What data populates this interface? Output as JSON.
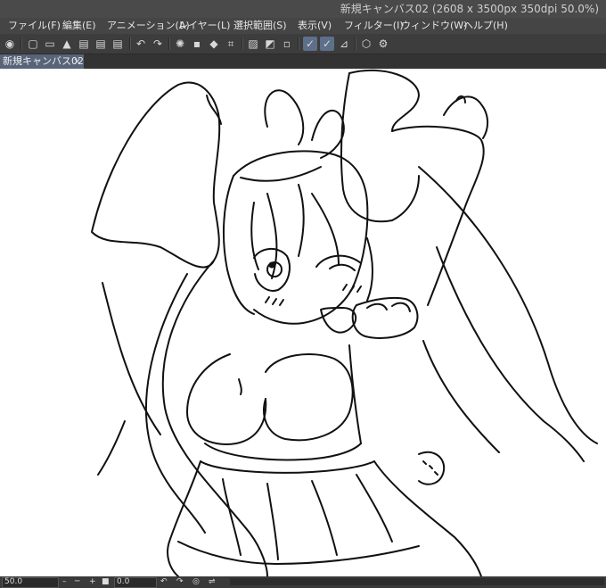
{
  "window": {
    "title": "新規キャンバス02 (2608 x 3500px 350dpi 50.0%)"
  },
  "menu": {
    "items": [
      "ファイル(F)",
      "編集(E)",
      "アニメーション(A)",
      "レイヤー(L)",
      "選択範囲(S)",
      "表示(V)",
      "フィルター(I)",
      "ウィンドウ(W)",
      "ヘルプ(H)"
    ]
  },
  "tabs": [
    {
      "label": "新規キャンバス02",
      "close": "×"
    }
  ],
  "toolbar": {
    "icons": [
      "clip-studio-icon",
      "new-icon",
      "open-icon",
      "save-icon",
      "export-jpg-icon",
      "export-png-icon",
      "export-webp-icon",
      "undo-icon",
      "redo-icon",
      "clear-icon",
      "fill-icon",
      "transform-icon",
      "deselect-icon",
      "invert-icon",
      "hide-selection-icon",
      "snap-ruler-icon",
      "snap-special-ruler-icon",
      "snap-grid-icon",
      "cube-icon",
      "settings-icon"
    ]
  },
  "status": {
    "zoom": "50.0",
    "rotation": "0.0"
  }
}
